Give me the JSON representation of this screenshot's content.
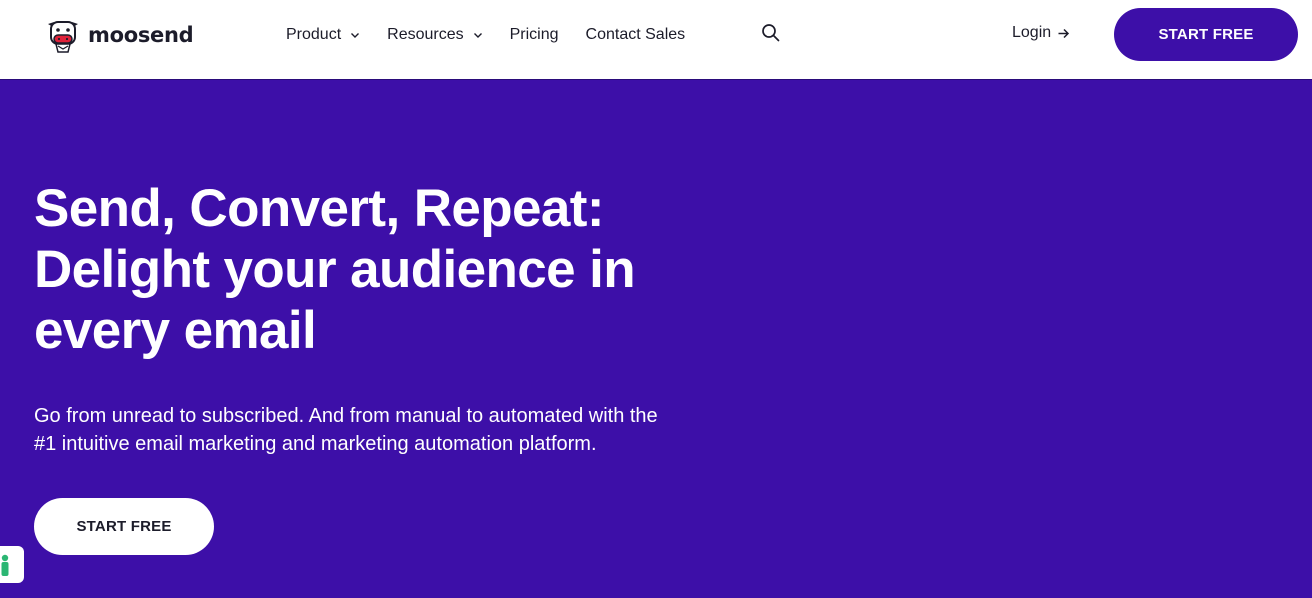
{
  "brand": {
    "name": "moosend",
    "logo_icon": "cow-mascot-icon",
    "accent_color": "#3d0fa8"
  },
  "nav": {
    "items": [
      {
        "label": "Product",
        "has_dropdown": true
      },
      {
        "label": "Resources",
        "has_dropdown": true
      },
      {
        "label": "Pricing",
        "has_dropdown": false
      },
      {
        "label": "Contact Sales",
        "has_dropdown": false
      }
    ],
    "search_icon": "search-icon",
    "login_label": "Login",
    "login_icon": "arrow-right-icon",
    "cta_label": "START FREE"
  },
  "hero": {
    "title_lines": [
      "Send, Convert, Repeat:",
      "Delight your audience in",
      "every email"
    ],
    "subtitle_lines": [
      "Go from unread to subscribed. And from manual to automated with the",
      "#1 intuitive email marketing and marketing automation platform."
    ],
    "cta_label": "START FREE"
  },
  "accessibility_widget": {
    "icon": "accessibility-person-icon"
  }
}
